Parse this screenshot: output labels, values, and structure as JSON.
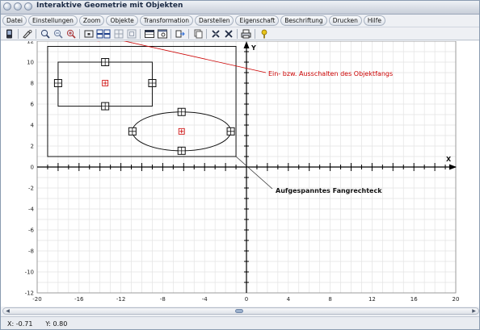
{
  "window": {
    "title": "Interaktive Geometrie mit Objekten"
  },
  "menu": [
    "Datei",
    "Einstellungen",
    "Zoom",
    "Objekte",
    "Transformation",
    "Darstellen",
    "Eigenschaft",
    "Beschriftung",
    "Drucken",
    "Hilfe"
  ],
  "toolbar": {
    "items": [
      "phone-icon",
      "pencil-icon",
      "zoom-in-icon",
      "zoom-out-icon",
      "zoom-fit-icon",
      "snap-icon",
      "snap-toggle-icon",
      "grid-icon-1",
      "grid-icon-2",
      "table-icon",
      "window-icon",
      "export-icon",
      "copy-icon",
      "cross-icon-1",
      "cross-icon-2",
      "print-icon",
      "help-icon"
    ],
    "snap_text": "⊞⊞"
  },
  "annotations": {
    "snap_callout": "Ein- bzw. Ausschalten des Objektfangs",
    "rect_callout": "Aufgespanntes Fangrechteck"
  },
  "axes": {
    "x_label": "X",
    "y_label": "Y",
    "x_ticks": [
      "-20",
      "-16",
      "-12",
      "-8",
      "-4",
      "0",
      "4",
      "8",
      "12",
      "16",
      "20"
    ],
    "y_ticks": [
      "12",
      "10",
      "8",
      "6",
      "4",
      "2",
      "0",
      "-2",
      "-4",
      "-6",
      "-8",
      "-10",
      "-12"
    ]
  },
  "status": {
    "x": "X: -0.71",
    "y": "Y: 0.80"
  },
  "colors": {
    "accent": "#cc0000",
    "grid": "#e3e3e3",
    "axis": "#000000",
    "toolbar_icon": "#1e3f8a"
  },
  "geometry_data": {
    "x_range": [
      -20,
      20
    ],
    "y_range": [
      -12,
      12
    ],
    "fang_rect": {
      "x1": -19,
      "y1": 1,
      "x2": -1,
      "y2": 11.5
    },
    "rectangle": {
      "x1": -18,
      "y1": 5.8,
      "x2": -9,
      "y2": 10
    },
    "rect_center": [
      -13.5,
      8
    ],
    "rect_handles": [
      [
        -18,
        8
      ],
      [
        -9,
        8
      ],
      [
        -13.5,
        10
      ],
      [
        -13.5,
        5.8
      ]
    ],
    "ellipse": {
      "cx": -6.2,
      "cy": 3.4,
      "rx": 4.7,
      "ry": 1.85
    },
    "ellipse_handles": [
      [
        -10.9,
        3.4
      ],
      [
        -1.5,
        3.4
      ],
      [
        -6.2,
        5.25
      ],
      [
        -6.2,
        1.55
      ]
    ]
  }
}
